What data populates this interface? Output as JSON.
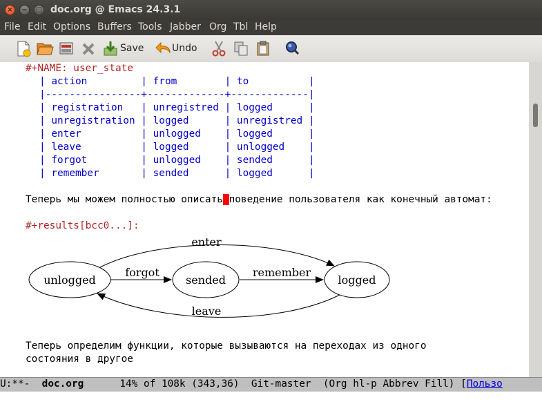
{
  "window": {
    "title": "doc.org @ Emacs 24.3.1",
    "close": "×",
    "minimize": "−",
    "maximize": "□"
  },
  "menu": [
    "File",
    "Edit",
    "Options",
    "Buffers",
    "Tools",
    "Jabber",
    "Org",
    "Tbl",
    "Help"
  ],
  "toolbar": {
    "icons": [
      "new-file-icon",
      "open-file-icon",
      "dired-icon",
      "close-buffer-icon",
      "save-icon",
      "undo-icon",
      "cut-icon",
      "copy-icon",
      "paste-icon",
      "search-icon"
    ],
    "save_label": "Save",
    "undo_label": "Undo"
  },
  "buffer": {
    "name_line": "#+NAME: user_state",
    "table": {
      "header": "| action         | from        | to          |",
      "separator": "|----------------+-------------+-------------|",
      "rows": [
        "| registration   | unregistred | logged      |",
        "| unregistration | logged      | unregistred |",
        "| enter          | unlogged    | logged      |",
        "| leave          | logged      | unlogged    |",
        "| forgot         | unlogged    | sended      |",
        "| remember       | sended      | logged      |"
      ]
    },
    "paragraph1_before": "Теперь мы можем полностью описать",
    "paragraph1_cursor": " ",
    "paragraph1_after": "поведение пользователя как конечный автомат:",
    "results_line": "#+results[bcc0...]:",
    "diagram": {
      "nodes": [
        "unlogged",
        "sended",
        "logged"
      ],
      "edges": [
        "enter",
        "forgot",
        "remember",
        "leave"
      ]
    },
    "paragraph2_line1": "Теперь определим функции, которые вызываются на переходах из одного",
    "paragraph2_line2": "состояния в другое"
  },
  "modeline": {
    "status": "U:**-  ",
    "buffer_name": "doc.org",
    "position": "      14% of 108k (343,36)  Git-master  (Org hl-p Abbrev Fill) [",
    "link": "Пользо"
  }
}
